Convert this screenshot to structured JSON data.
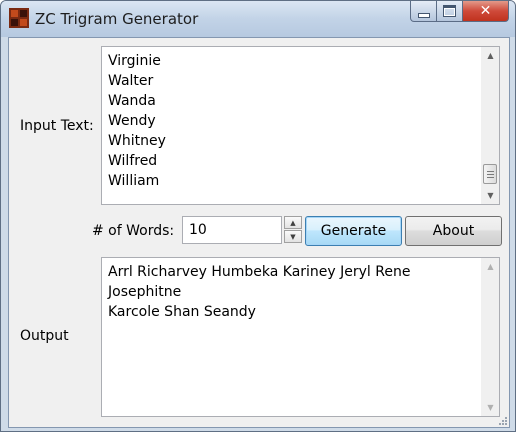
{
  "window": {
    "title": "ZC Trigram Generator"
  },
  "labels": {
    "input_text": "Input Text:",
    "num_words": "# of Words:",
    "output": "Output"
  },
  "input_list": [
    "Virginie",
    "Walter",
    "Wanda",
    "Wendy",
    "Whitney",
    "Wilfred",
    "William"
  ],
  "num_words_value": "10",
  "buttons": {
    "generate": "Generate",
    "about": "About"
  },
  "output_lines": [
    "Arrl Richarvey Humbeka Kariney Jeryl Rene Josephitne",
    "Karcole Shan Seandy"
  ],
  "icons": {
    "minimize": "minimize-icon",
    "maximize": "maximize-icon",
    "close": "close-icon",
    "scroll_up": "chevron-up-icon",
    "scroll_down": "chevron-down-icon",
    "spin_up": "chevron-up-icon",
    "spin_down": "chevron-down-icon"
  },
  "colors": {
    "titlebar": "#c2d3e7",
    "close_button": "#c0321e",
    "focus_border": "#3c7fb1"
  }
}
